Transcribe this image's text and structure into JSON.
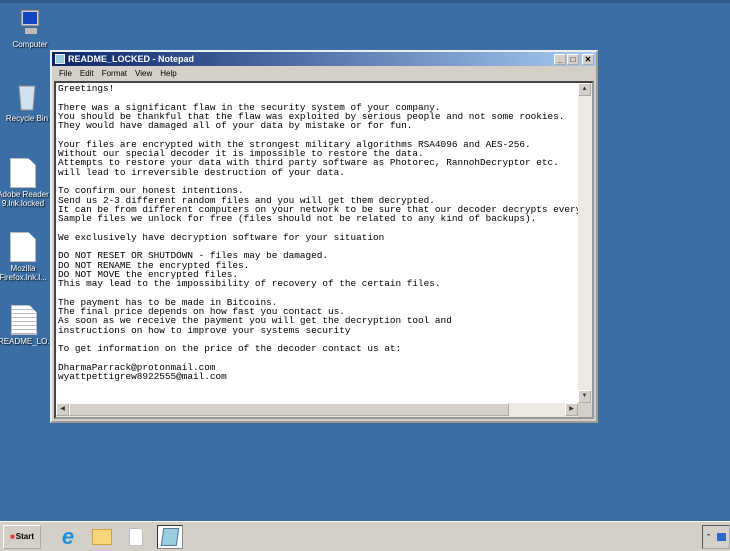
{
  "desktop": {
    "icons": [
      {
        "label": "Computer",
        "icon": "computer-icon"
      },
      {
        "label": "Recycle Bin",
        "icon": "recycle-bin-icon"
      },
      {
        "label": "Adobe Reader 9.lnk.locked",
        "icon": "file-icon"
      },
      {
        "label": "Mozilla Firefox.lnk.l...",
        "icon": "file-icon"
      },
      {
        "label": "README_LO...",
        "icon": "text-file-icon"
      }
    ]
  },
  "notepad": {
    "title": "README_LOCKED - Notepad",
    "menu": [
      "File",
      "Edit",
      "Format",
      "View",
      "Help"
    ],
    "lines": [
      "Greetings!",
      "",
      "There was a significant flaw in the security system of your company.",
      "You should be thankful that the flaw was exploited by serious people and not some rookies.",
      "They would have damaged all of your data by mistake or for fun.",
      "",
      "Your files are encrypted with the strongest military algorithms RSA4096 and AES-256.",
      "Without our special decoder it is impossible to restore the data.",
      "Attempts to restore your data with third party software as Photorec, RannohDecryptor etc.",
      "will lead to irreversible destruction of your data.",
      "",
      "To confirm our honest intentions.",
      "Send us 2-3 different random files and you will get them decrypted.",
      "It can be from different computers on your network to be sure that our decoder decrypts every",
      "Sample files we unlock for free (files should not be related to any kind of backups).",
      "",
      "We exclusively have decryption software for your situation",
      "",
      "DO NOT RESET OR SHUTDOWN - files may be damaged.",
      "DO NOT RENAME the encrypted files.",
      "DO NOT MOVE the encrypted files.",
      "This may lead to the impossibility of recovery of the certain files.",
      "",
      "The payment has to be made in Bitcoins.",
      "The final price depends on how fast you contact us.",
      "As soon as we receive the payment you will get the decryption tool and",
      "instructions on how to improve your systems security",
      "",
      "To get information on the price of the decoder contact us at:",
      "",
      "DharmaParrack@protonmail.com",
      "wyattpettigrew8922555@mail.com"
    ]
  },
  "taskbar": {
    "start_label": "Start",
    "items": [
      "internet-explorer-icon",
      "explorer-icon",
      "file-icon",
      "notepad-icon"
    ]
  }
}
